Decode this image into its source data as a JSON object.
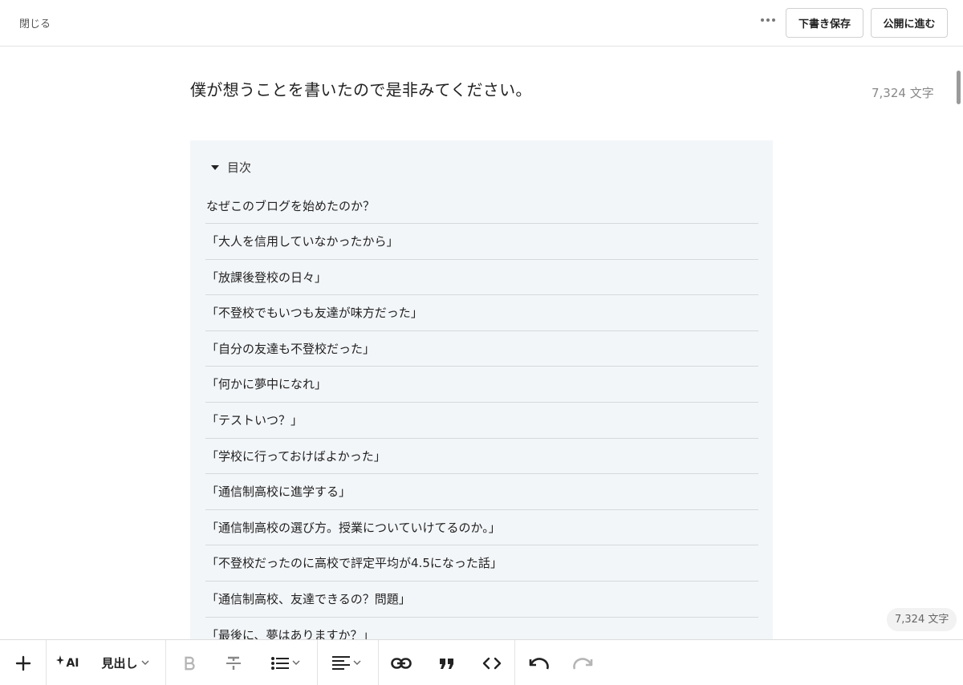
{
  "header": {
    "close_label": "閉じる",
    "draft_label": "下書き保存",
    "publish_label": "公開に進む"
  },
  "article": {
    "title": "僕が想うことを書いたので是非みてください。",
    "char_count": "7,324 文字"
  },
  "toc": {
    "label": "目次",
    "items": [
      "なぜこのブログを始めたのか？",
      "「大人を信用していなかったから」",
      "「放課後登校の日々」",
      "「不登校でもいつも友達が味方だった」",
      "「自分の友達も不登校だった」",
      "「何かに夢中になれ」",
      "「テストいつ？」",
      "「学校に行っておけばよかった」",
      "「通信制高校に進学する」",
      "「通信制高校の選び方。授業についていけてるのか。」",
      "「不登校だったのに高校で評定平均が4.5になった話」",
      "「通信制高校、友達できるの？問題」",
      "「最後に、夢はありますか？」"
    ]
  },
  "floating": {
    "char_count": "7,324 文字"
  },
  "toolbar": {
    "ai_label": "AI",
    "heading_label": "見出し",
    "icons": [
      "plus-icon",
      "ai-sparkle-icon",
      "bold-icon",
      "strikethrough-icon",
      "bullet-list-icon",
      "align-left-icon",
      "link-icon",
      "quote-icon",
      "code-icon",
      "undo-icon",
      "redo-icon"
    ]
  }
}
